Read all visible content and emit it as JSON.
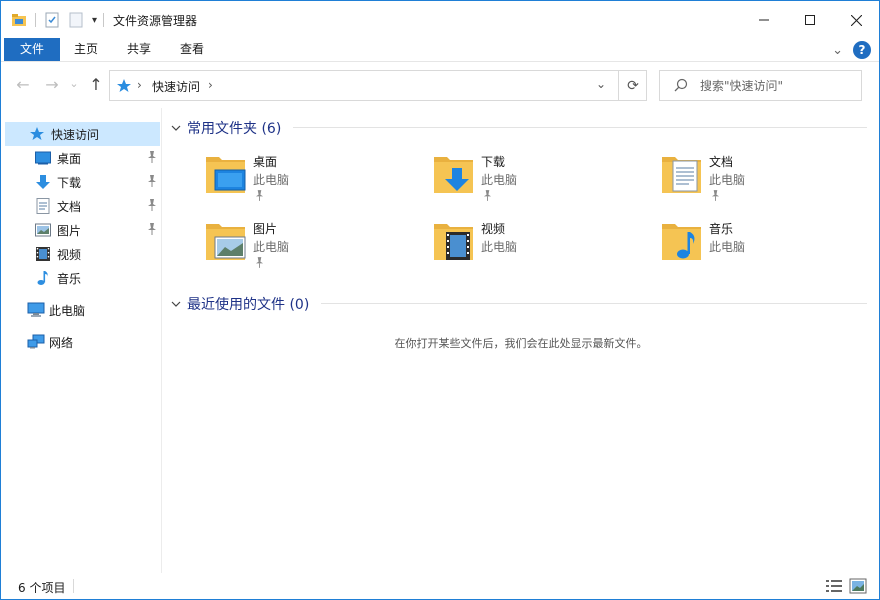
{
  "window": {
    "title": "文件资源管理器",
    "qa_toolbar": {
      "customize": "▾"
    }
  },
  "ribbon": {
    "tabs": [
      {
        "label": "文件",
        "active": true
      },
      {
        "label": "主页"
      },
      {
        "label": "共享"
      },
      {
        "label": "查看"
      }
    ],
    "collapse": "⌄",
    "help": "?"
  },
  "nav": {
    "back": "←",
    "forward": "→",
    "recent": "⌄",
    "up": "↑",
    "breadcrumb": "快速访问",
    "search_placeholder": "搜索\"快速访问\""
  },
  "sidebar": {
    "items": [
      {
        "label": "快速访问",
        "icon": "star-icon",
        "selected": true
      },
      {
        "label": "桌面",
        "icon": "desktop-icon",
        "pinned": true
      },
      {
        "label": "下载",
        "icon": "download-icon",
        "pinned": true
      },
      {
        "label": "文档",
        "icon": "document-icon",
        "pinned": true
      },
      {
        "label": "图片",
        "icon": "picture-icon",
        "pinned": true
      },
      {
        "label": "视频",
        "icon": "video-icon"
      },
      {
        "label": "音乐",
        "icon": "music-icon"
      },
      {
        "label": "此电脑",
        "icon": "computer-icon"
      },
      {
        "label": "网络",
        "icon": "network-icon"
      }
    ]
  },
  "main": {
    "frequent_header": "常用文件夹 (6)",
    "recent_header": "最近使用的文件 (0)",
    "empty_message": "在你打开某些文件后，我们会在此处显示最新文件。",
    "folders": [
      {
        "name": "桌面",
        "location": "此电脑",
        "pinned": true,
        "icon": "desktop-folder-icon"
      },
      {
        "name": "下载",
        "location": "此电脑",
        "pinned": true,
        "icon": "download-folder-icon"
      },
      {
        "name": "文档",
        "location": "此电脑",
        "pinned": true,
        "icon": "document-folder-icon"
      },
      {
        "name": "图片",
        "location": "此电脑",
        "pinned": true,
        "icon": "picture-folder-icon"
      },
      {
        "name": "视频",
        "location": "此电脑",
        "pinned": false,
        "icon": "video-folder-icon"
      },
      {
        "name": "音乐",
        "location": "此电脑",
        "pinned": false,
        "icon": "music-folder-icon"
      }
    ]
  },
  "status": {
    "count": "6 个项目"
  },
  "colors": {
    "accent": "#1f6dc1",
    "selection": "#cce8ff",
    "group_header": "#1e3287",
    "folder": "#f5c453"
  }
}
